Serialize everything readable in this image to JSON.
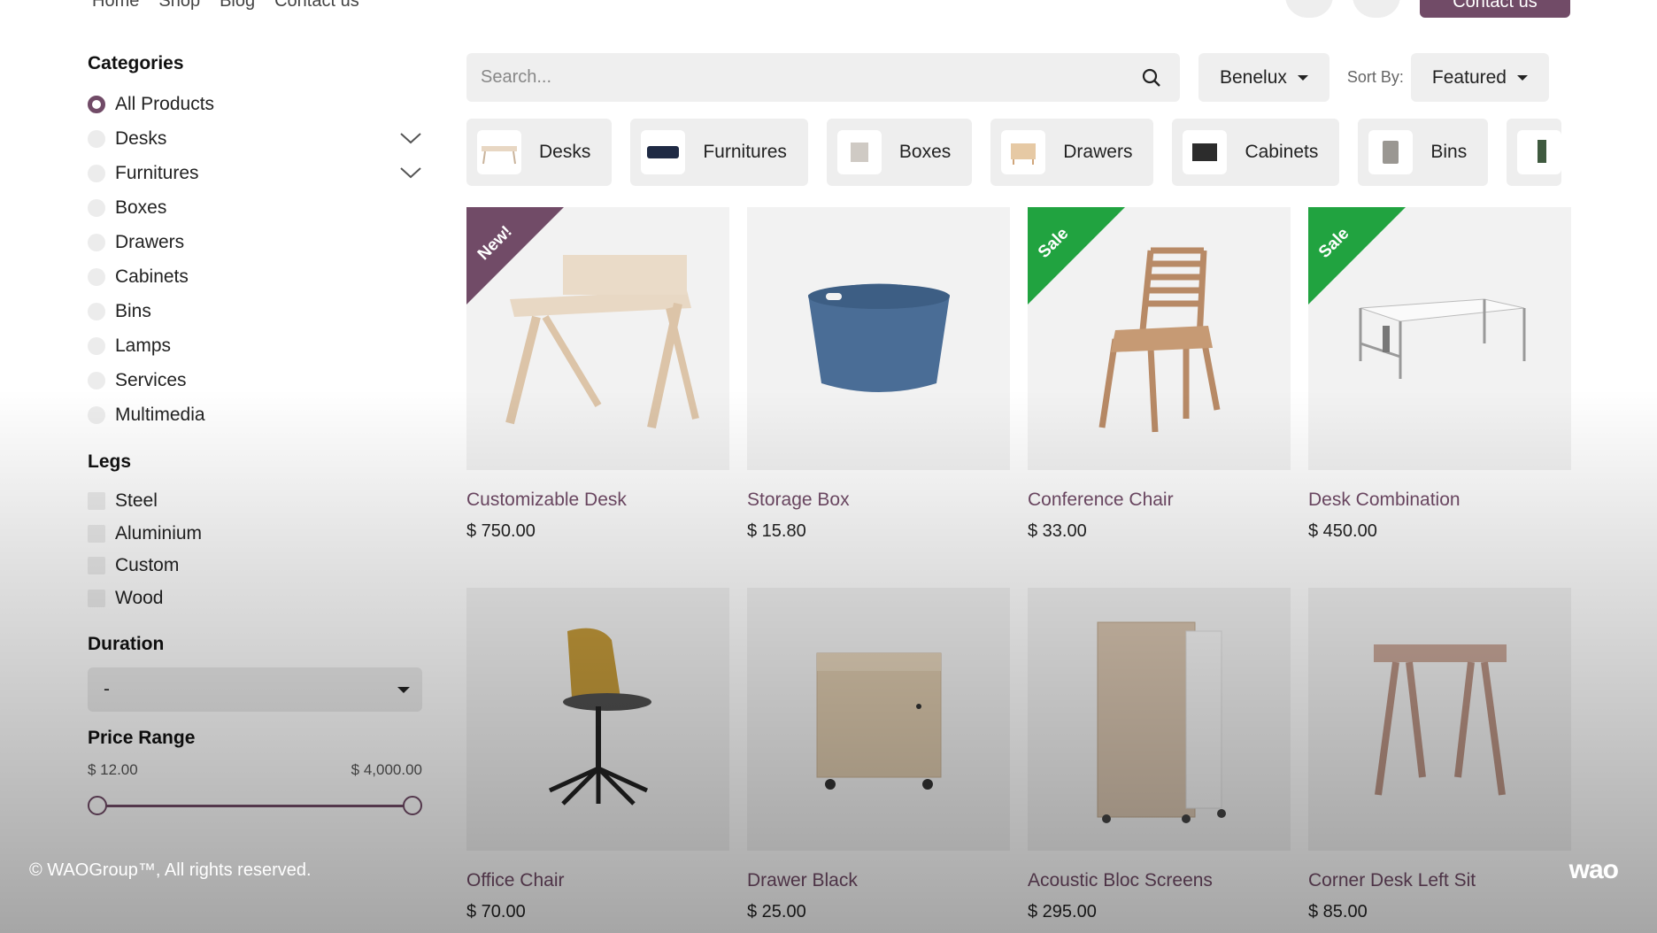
{
  "nav": {
    "links": [
      "Home",
      "Shop",
      "Blog",
      "Contact us"
    ],
    "contact_label": "Contact us"
  },
  "sidebar": {
    "categories_title": "Categories",
    "categories": [
      {
        "label": "All Products",
        "checked": true,
        "expandable": false
      },
      {
        "label": "Desks",
        "checked": false,
        "expandable": true
      },
      {
        "label": "Furnitures",
        "checked": false,
        "expandable": true
      },
      {
        "label": "Boxes",
        "checked": false,
        "expandable": false
      },
      {
        "label": "Drawers",
        "checked": false,
        "expandable": false
      },
      {
        "label": "Cabinets",
        "checked": false,
        "expandable": false
      },
      {
        "label": "Bins",
        "checked": false,
        "expandable": false
      },
      {
        "label": "Lamps",
        "checked": false,
        "expandable": false
      },
      {
        "label": "Services",
        "checked": false,
        "expandable": false
      },
      {
        "label": "Multimedia",
        "checked": false,
        "expandable": false
      }
    ],
    "legs_title": "Legs",
    "legs": [
      "Steel",
      "Aluminium",
      "Custom",
      "Wood"
    ],
    "duration_title": "Duration",
    "duration_value": "-",
    "price_title": "Price Range",
    "price_min": "$ 12.00",
    "price_max": "$ 4,000.00"
  },
  "toolbar": {
    "search_placeholder": "Search...",
    "pricelist": "Benelux",
    "sort_label": "Sort By:",
    "sort_value": "Featured"
  },
  "category_tiles": [
    "Desks",
    "Furnitures",
    "Boxes",
    "Drawers",
    "Cabinets",
    "Bins"
  ],
  "products": [
    {
      "name": "Customizable Desk",
      "price": "$ 750.00",
      "ribbon": "New!",
      "ribbon_color": "#714b67",
      "icon": "desk-icon"
    },
    {
      "name": "Storage Box",
      "price": "$ 15.80",
      "ribbon": "",
      "icon": "box-icon"
    },
    {
      "name": "Conference Chair",
      "price": "$ 33.00",
      "ribbon": "Sale",
      "ribbon_color": "#21a340",
      "icon": "chair-icon"
    },
    {
      "name": "Desk Combination",
      "price": "$ 450.00",
      "ribbon": "Sale",
      "ribbon_color": "#21a340",
      "icon": "desk-combo-icon"
    },
    {
      "name": "Office Chair",
      "price": "$ 70.00",
      "ribbon": "",
      "icon": "office-chair-icon"
    },
    {
      "name": "Drawer Black",
      "price": "$ 25.00",
      "ribbon": "",
      "icon": "drawer-icon"
    },
    {
      "name": "Acoustic Bloc Screens",
      "price": "$ 295.00",
      "ribbon": "",
      "icon": "screen-icon"
    },
    {
      "name": "Corner Desk Left Sit",
      "price": "$ 85.00",
      "ribbon": "",
      "icon": "corner-desk-icon"
    }
  ],
  "footer": {
    "copyright": "© WAOGroup™, All rights reserved.",
    "logo": "wao"
  },
  "colors": {
    "brand": "#714b67",
    "sale": "#21a340"
  }
}
